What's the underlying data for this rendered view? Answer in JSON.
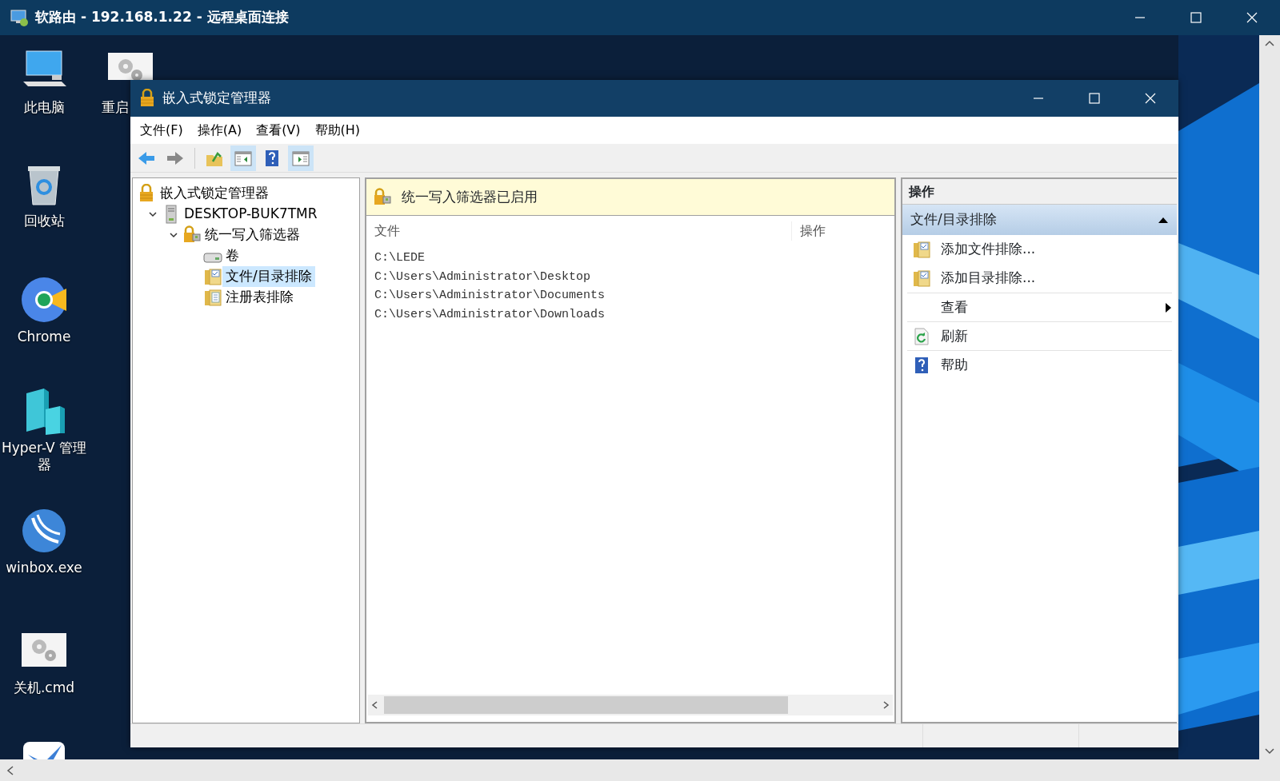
{
  "rdp_window": {
    "title": "软路由 - 192.168.1.22 - 远程桌面连接"
  },
  "desktop_icons": [
    {
      "label": "此电脑",
      "kind": "computer"
    },
    {
      "label": "重启",
      "kind": "script"
    },
    {
      "label": "回收站",
      "kind": "recycle"
    },
    {
      "label": "Chrome",
      "kind": "chrome"
    },
    {
      "label": "Hyper-V 管理器",
      "kind": "hyperv"
    },
    {
      "label": "winbox.exe",
      "kind": "winbox"
    },
    {
      "label": "关机.cmd",
      "kind": "script"
    },
    {
      "kind": "bird"
    }
  ],
  "window": {
    "title": "嵌入式锁定管理器"
  },
  "menu": [
    "文件(F)",
    "操作(A)",
    "查看(V)",
    "帮助(H)"
  ],
  "toolbar": [
    {
      "kind": "back",
      "pressed": false
    },
    {
      "kind": "forward",
      "pressed": false
    },
    {
      "kind": "up",
      "pressed": false
    },
    {
      "kind": "tree",
      "pressed": true
    },
    {
      "kind": "help",
      "pressed": false
    },
    {
      "kind": "pane",
      "pressed": true
    }
  ],
  "tree": [
    {
      "label": "嵌入式锁定管理器",
      "kind": "lock",
      "selected": false,
      "children": [
        {
          "label": "DESKTOP-BUK7TMR",
          "kind": "server",
          "expanded": true,
          "selected": false,
          "children": [
            {
              "label": "统一写入筛选器",
              "kind": "filter",
              "expanded": true,
              "selected": false,
              "children": [
                {
                  "label": "卷",
                  "kind": "drive",
                  "selected": false
                },
                {
                  "label": "文件/目录排除",
                  "kind": "folder",
                  "selected": true
                },
                {
                  "label": "注册表排除",
                  "kind": "registry",
                  "selected": false
                }
              ]
            }
          ]
        }
      ]
    }
  ],
  "banner": {
    "text": "统一写入筛选器已启用"
  },
  "table": {
    "columns": [
      "文件",
      "操作"
    ],
    "rows": [
      {
        "file": "C:\\LEDE"
      },
      {
        "file": "C:\\Users\\Administrator\\Desktop"
      },
      {
        "file": "C:\\Users\\Administrator\\Documents"
      },
      {
        "file": "C:\\Users\\Administrator\\Downloads"
      }
    ]
  },
  "actions": {
    "title": "操作",
    "section": {
      "title": "文件/目录排除",
      "expanded": true
    },
    "items": [
      {
        "label": "添加文件排除...",
        "kind": "folder"
      },
      {
        "label": "添加目录排除...",
        "kind": "folder"
      },
      {
        "label": "查看",
        "kind": "submenu"
      },
      {
        "label": "刷新",
        "kind": "refresh"
      },
      {
        "label": "帮助",
        "kind": "help"
      }
    ]
  }
}
